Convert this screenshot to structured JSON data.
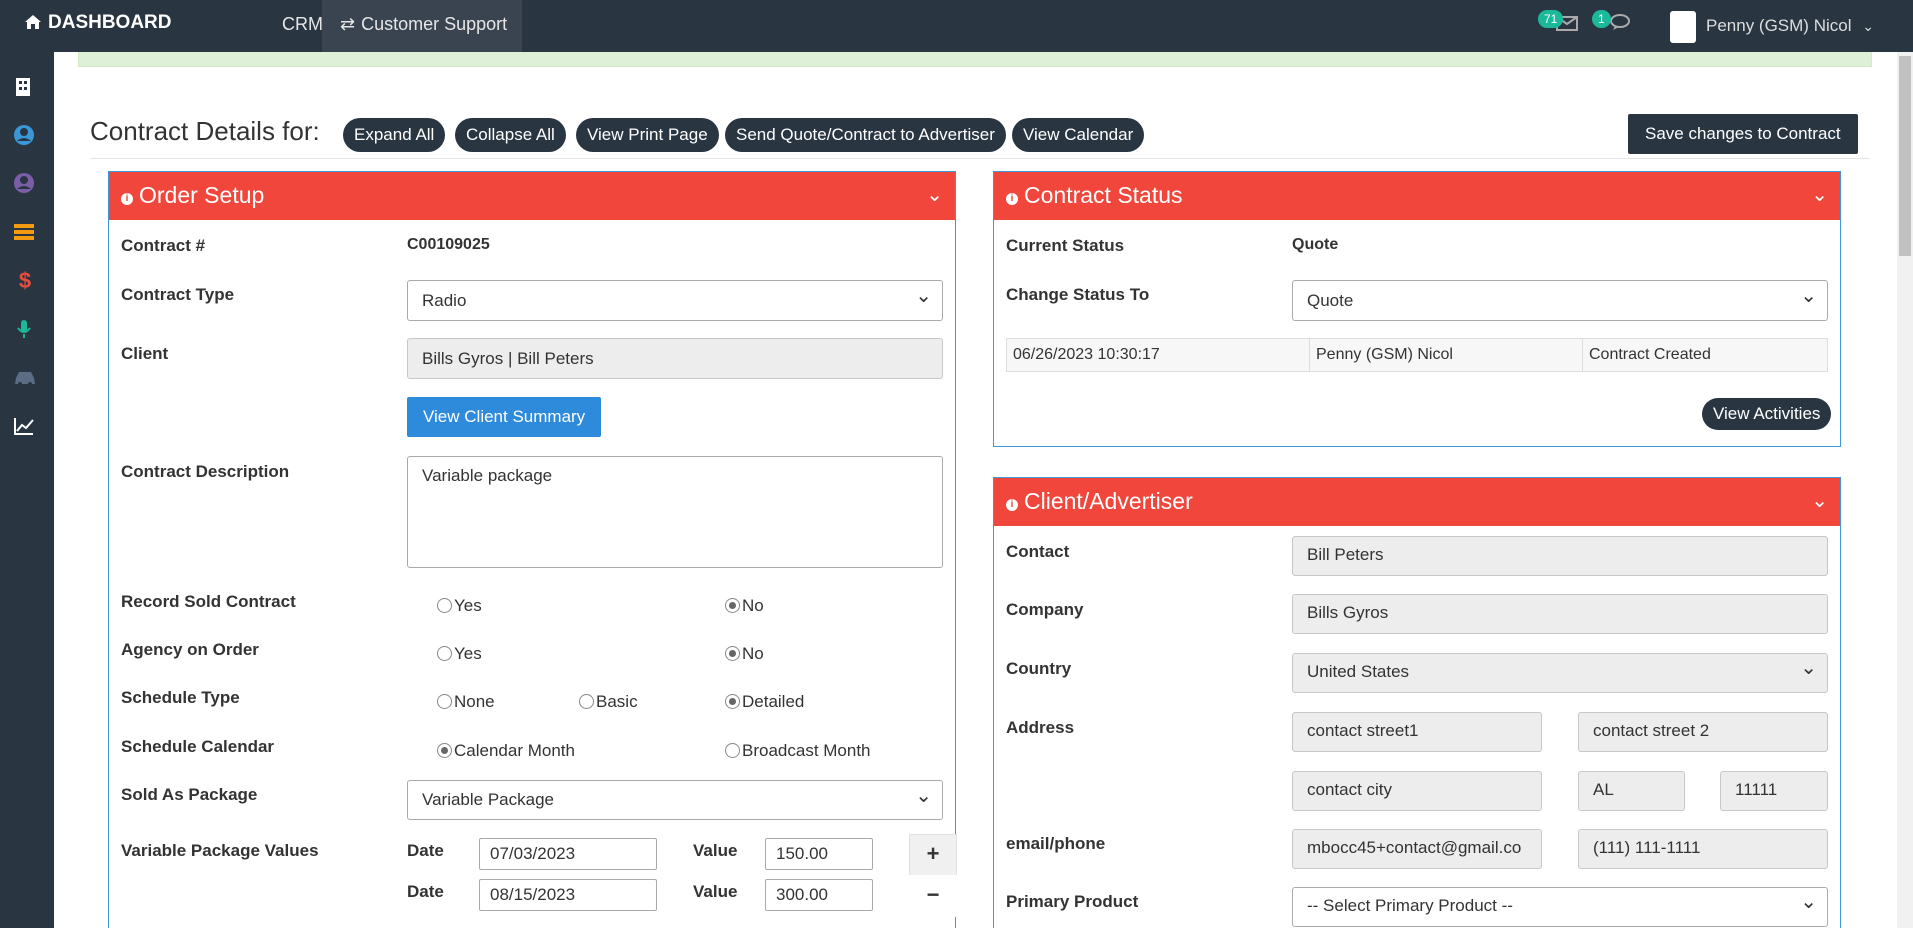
{
  "header": {
    "brand": "DASHBOARD",
    "nav": {
      "crm": "CRM",
      "customer_support": "Customer Support"
    },
    "mail_count": "71",
    "chat_count": "1",
    "user_name": "Penny (GSM) Nicol"
  },
  "sidebar": {
    "icons": [
      "building-icon",
      "user-circle-icon",
      "user-circle-icon",
      "list-icon",
      "dollar-icon",
      "microphone-icon",
      "car-icon",
      "chart-line-icon"
    ]
  },
  "toolbar": {
    "title": "Contract Details for:",
    "expand_all": "Expand All",
    "collapse_all": "Collapse All",
    "view_print": "View Print Page",
    "send_quote": "Send Quote/Contract to Advertiser",
    "view_calendar": "View Calendar",
    "save": "Save changes to Contract"
  },
  "order_setup": {
    "title": "Order Setup",
    "contract_no_label": "Contract #",
    "contract_no": "C00109025",
    "contract_type_label": "Contract Type",
    "contract_type": "Radio",
    "client_label": "Client",
    "client": "Bills Gyros | Bill Peters",
    "view_client_summary": "View Client Summary",
    "description_label": "Contract Description",
    "description": "Variable package",
    "record_sold_label": "Record Sold Contract",
    "agency_label": "Agency on Order",
    "yes": "Yes",
    "no": "No",
    "schedule_type_label": "Schedule Type",
    "schedule_none": "None",
    "schedule_basic": "Basic",
    "schedule_detailed": "Detailed",
    "schedule_calendar_label": "Schedule Calendar",
    "calendar_month": "Calendar Month",
    "broadcast_month": "Broadcast Month",
    "sold_as_package_label": "Sold As Package",
    "sold_as_package": "Variable Package",
    "variable_values_label": "Variable Package Values",
    "date_label": "Date",
    "value_label": "Value",
    "rows": [
      {
        "date": "07/03/2023",
        "value": "150.00"
      },
      {
        "date": "08/15/2023",
        "value": "300.00"
      }
    ]
  },
  "contract_status": {
    "title": "Contract Status",
    "current_label": "Current Status",
    "current": "Quote",
    "change_label": "Change Status To",
    "change_value": "Quote",
    "history": [
      {
        "date": "06/26/2023 10:30:17",
        "user": "Penny (GSM) Nicol",
        "action": "Contract Created"
      }
    ],
    "view_activities": "View Activities"
  },
  "client_advertiser": {
    "title": "Client/Advertiser",
    "contact_label": "Contact",
    "contact": "Bill Peters",
    "company_label": "Company",
    "company": "Bills Gyros",
    "country_label": "Country",
    "country": "United States",
    "address_label": "Address",
    "street1": "contact street1",
    "street2": "contact street 2",
    "city": "contact city",
    "state": "AL",
    "zip": "11111",
    "email_phone_label": "email/phone",
    "email": "mbocc45+contact@gmail.co",
    "phone": "(111) 111-1111",
    "primary_product_label": "Primary Product",
    "primary_product": "-- Select Primary Product --"
  }
}
